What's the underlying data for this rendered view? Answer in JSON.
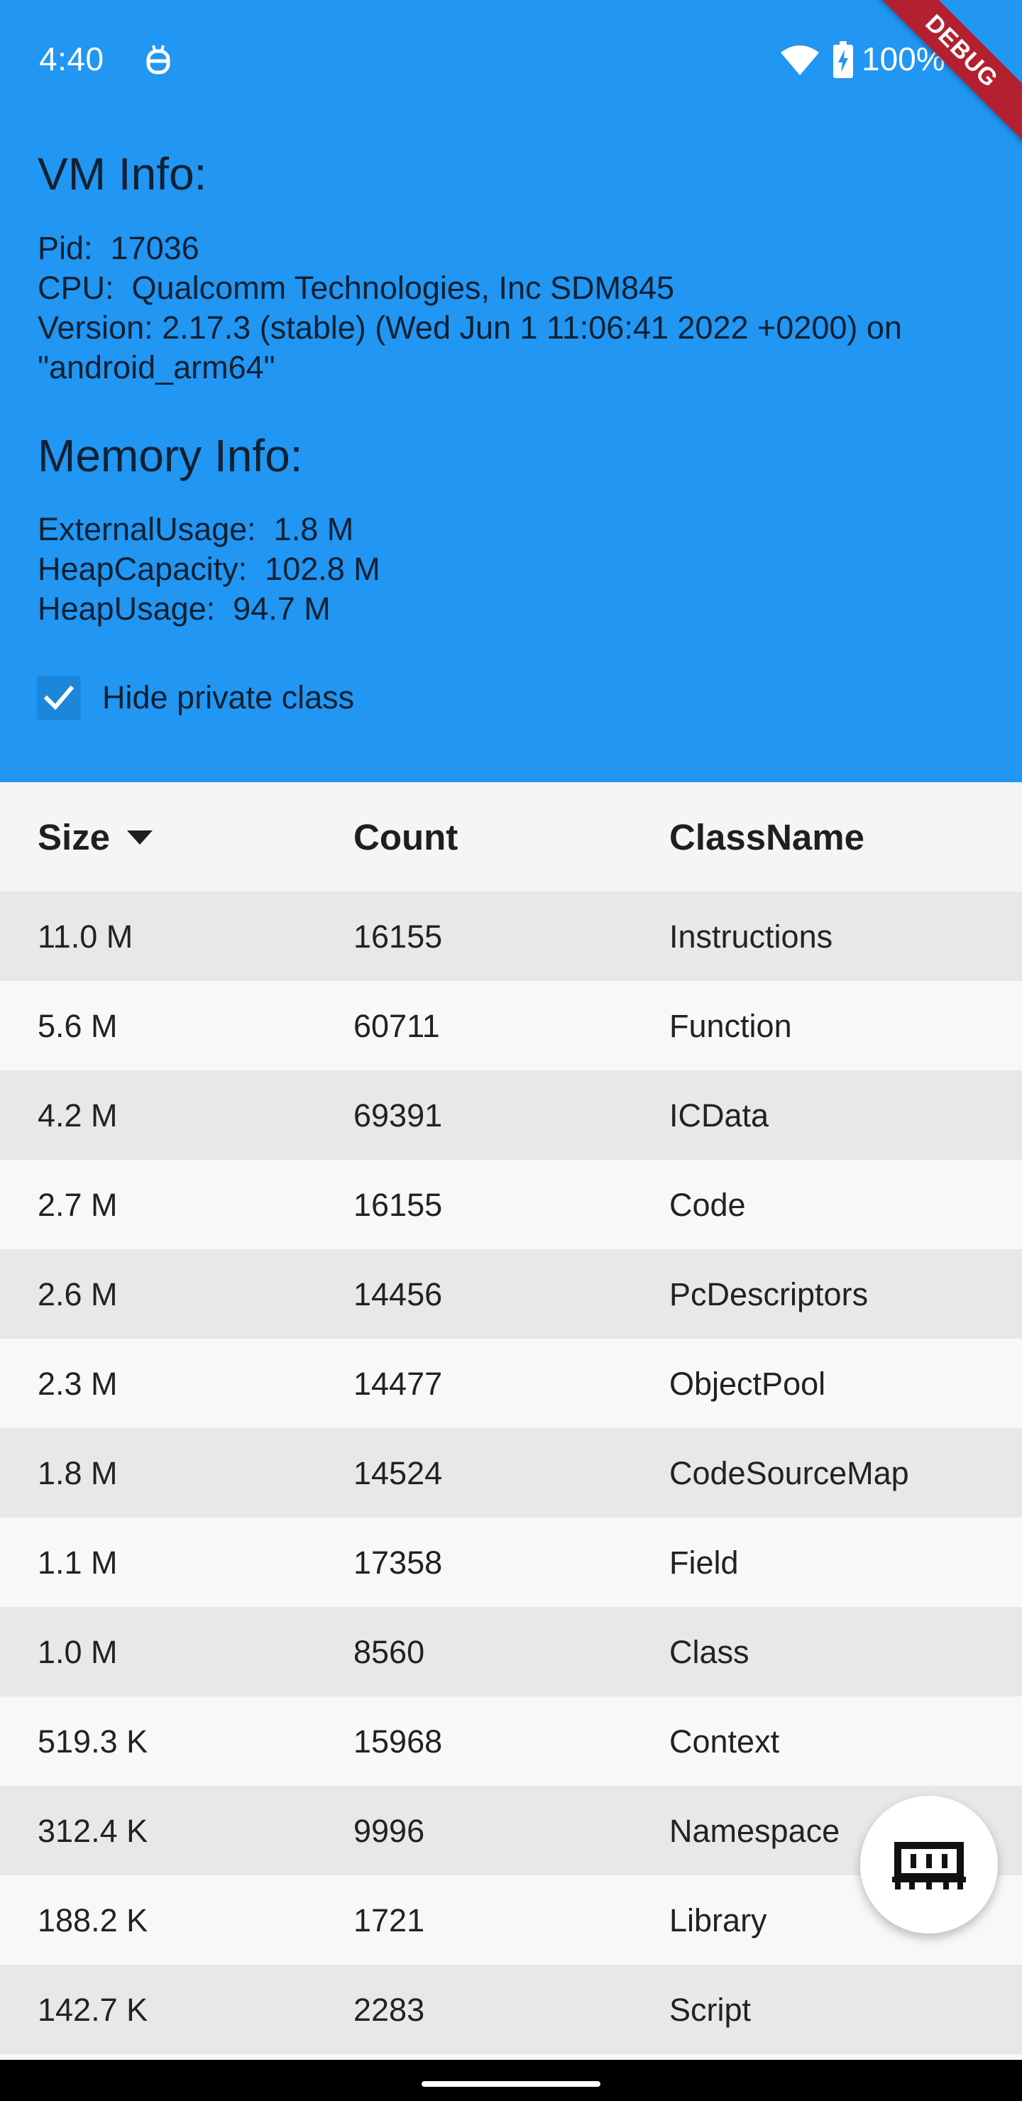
{
  "status_bar": {
    "time": "4:40",
    "battery": "100%"
  },
  "debug_banner": "DEBUG",
  "vm_info": {
    "title": "VM Info:",
    "pid": "Pid:  17036",
    "cpu": "CPU:  Qualcomm Technologies, Inc SDM845",
    "version": "Version:  2.17.3 (stable) (Wed Jun 1 11:06:41 2022 +0200) on \"android_arm64\""
  },
  "memory_info": {
    "title": "Memory Info:",
    "external_usage": "ExternalUsage:  1.8 M",
    "heap_capacity": "HeapCapacity:  102.8 M",
    "heap_usage": "HeapUsage:  94.7 M"
  },
  "hide_private": {
    "label": "Hide private class",
    "checked": true
  },
  "table": {
    "headers": {
      "size": "Size",
      "count": "Count",
      "class_name": "ClassName"
    },
    "rows": [
      {
        "size": "11.0 M",
        "count": "16155",
        "class_name": "Instructions"
      },
      {
        "size": "5.6 M",
        "count": "60711",
        "class_name": "Function"
      },
      {
        "size": "4.2 M",
        "count": "69391",
        "class_name": "ICData"
      },
      {
        "size": "2.7 M",
        "count": "16155",
        "class_name": "Code"
      },
      {
        "size": "2.6 M",
        "count": "14456",
        "class_name": "PcDescriptors"
      },
      {
        "size": "2.3 M",
        "count": "14477",
        "class_name": "ObjectPool"
      },
      {
        "size": "1.8 M",
        "count": "14524",
        "class_name": "CodeSourceMap"
      },
      {
        "size": "1.1 M",
        "count": "17358",
        "class_name": "Field"
      },
      {
        "size": "1.0 M",
        "count": "8560",
        "class_name": "Class"
      },
      {
        "size": "519.3 K",
        "count": "15968",
        "class_name": "Context"
      },
      {
        "size": "312.4 K",
        "count": "9996",
        "class_name": "Namespace"
      },
      {
        "size": "188.2 K",
        "count": "1721",
        "class_name": "Library"
      },
      {
        "size": "142.7 K",
        "count": "2283",
        "class_name": "Script"
      }
    ]
  },
  "colors": {
    "header_bg": "#2196f3",
    "checkbox": "#1c86db",
    "debug_ribbon": "#b3202f"
  },
  "icons": {
    "fab": "memory-chip-icon",
    "sort": "arrow-drop-down-icon"
  }
}
